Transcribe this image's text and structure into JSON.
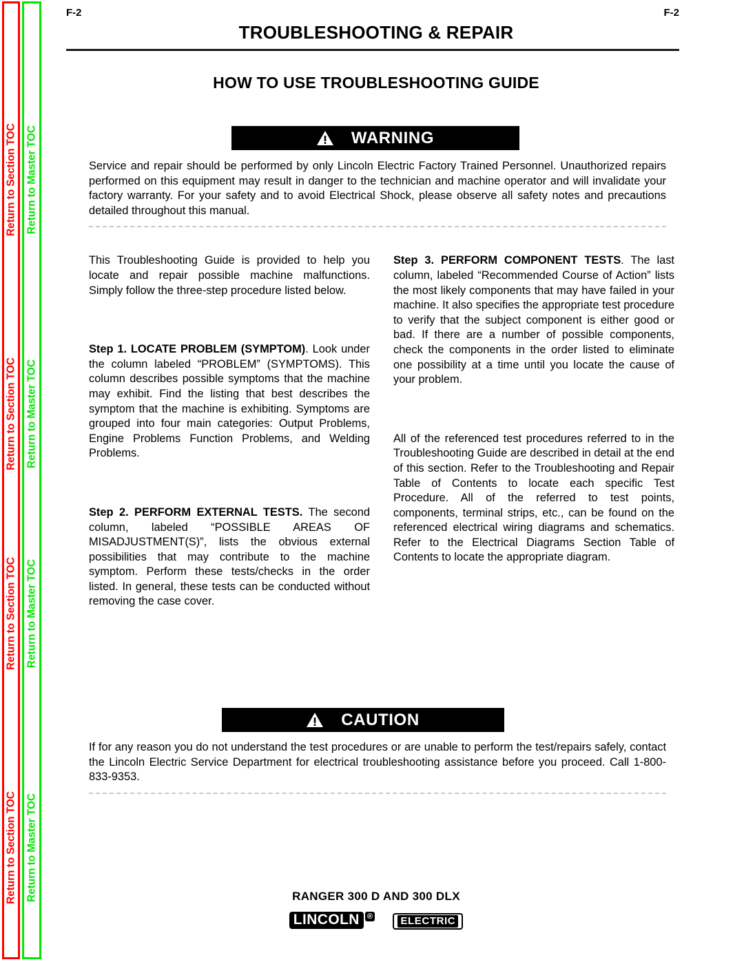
{
  "nav": {
    "section_toc_label": "Return to Section TOC",
    "master_toc_label": "Return to Master TOC",
    "section_toc_color": "#ff0000",
    "master_toc_color": "#00e800",
    "repeat_count": 4
  },
  "header": {
    "folio_left": "F-2",
    "folio_right": "F-2",
    "doc_title": "TROUBLESHOOTING & REPAIR",
    "section_title": "HOW TO USE TROUBLESHOOTING GUIDE"
  },
  "warning": {
    "label": "WARNING",
    "icon": "warning-triangle-icon",
    "body": "Service and repair should be performed by only Lincoln Electric Factory Trained Personnel.  Unauthorized repairs performed on this equipment may result in danger to the technician and machine operator and will invalidate your factory warranty.  For your safety and to avoid Electrical Shock, please observe all safety notes and precautions detailed throughout this manual."
  },
  "caution": {
    "label": "CAUTION",
    "icon": "warning-triangle-icon",
    "body": "If for any reason you do not understand the test procedures or are unable to perform the test/repairs safely, contact the Lincoln Electric Service Department for electrical troubleshooting assistance before you proceed.  Call 1-800-833-9353."
  },
  "left_column": {
    "intro": "This Troubleshooting Guide is provided to help you locate and repair possible machine malfunctions.  Simply follow the three-step procedure listed below.",
    "step1_lead": "Step 1. LOCATE PROBLEM (SYMPTOM)",
    "step1_body": ". Look under the column labeled “PROBLEM” (SYMPTOMS).  This column describes possible symptoms that the machine may exhibit.  Find the listing that best describes the symptom that the machine is exhibiting.  Symptoms are grouped into four main categories: Output Problems, Engine Problems Function Problems, and Welding Problems.",
    "step2_lead": "Step 2.  PERFORM EXTERNAL TESTS.",
    "step2_body": "  The second column, labeled “POSSIBLE AREAS OF MISADJUSTMENT(S)”, lists the obvious external possibilities that may contribute to the machine symptom.   Perform these tests/checks in the order listed.  In general, these tests can be conducted without removing the case cover."
  },
  "right_column": {
    "step3_lead": "Step 3.  PERFORM COMPONENT TESTS",
    "step3_body": ".  The last column, labeled “Recommended Course of Action” lists the most likely components that may have failed in your machine.  It also specifies the appropriate test procedure to verify that the subject component is either good or bad.  If there are a number of possible components, check the components in the order listed to eliminate one possibility at a time until you locate the cause of your problem.",
    "closing": "All of the referenced test procedures referred to in the Troubleshooting Guide are described in detail at the end of this section.   Refer to the Troubleshooting and Repair Table of Contents to locate each specific Test Procedure.  All of the referred to test points, components, terminal strips, etc., can be found on the referenced electrical wiring diagrams and schematics.  Refer to the Electrical Diagrams Section Table of Contents to locate the appropriate diagram."
  },
  "footer": {
    "model": "RANGER 300 D AND 300 DLX",
    "logo_word": "LINCOLN",
    "logo_reg": "®",
    "logo_sub": "ELECTRIC"
  }
}
